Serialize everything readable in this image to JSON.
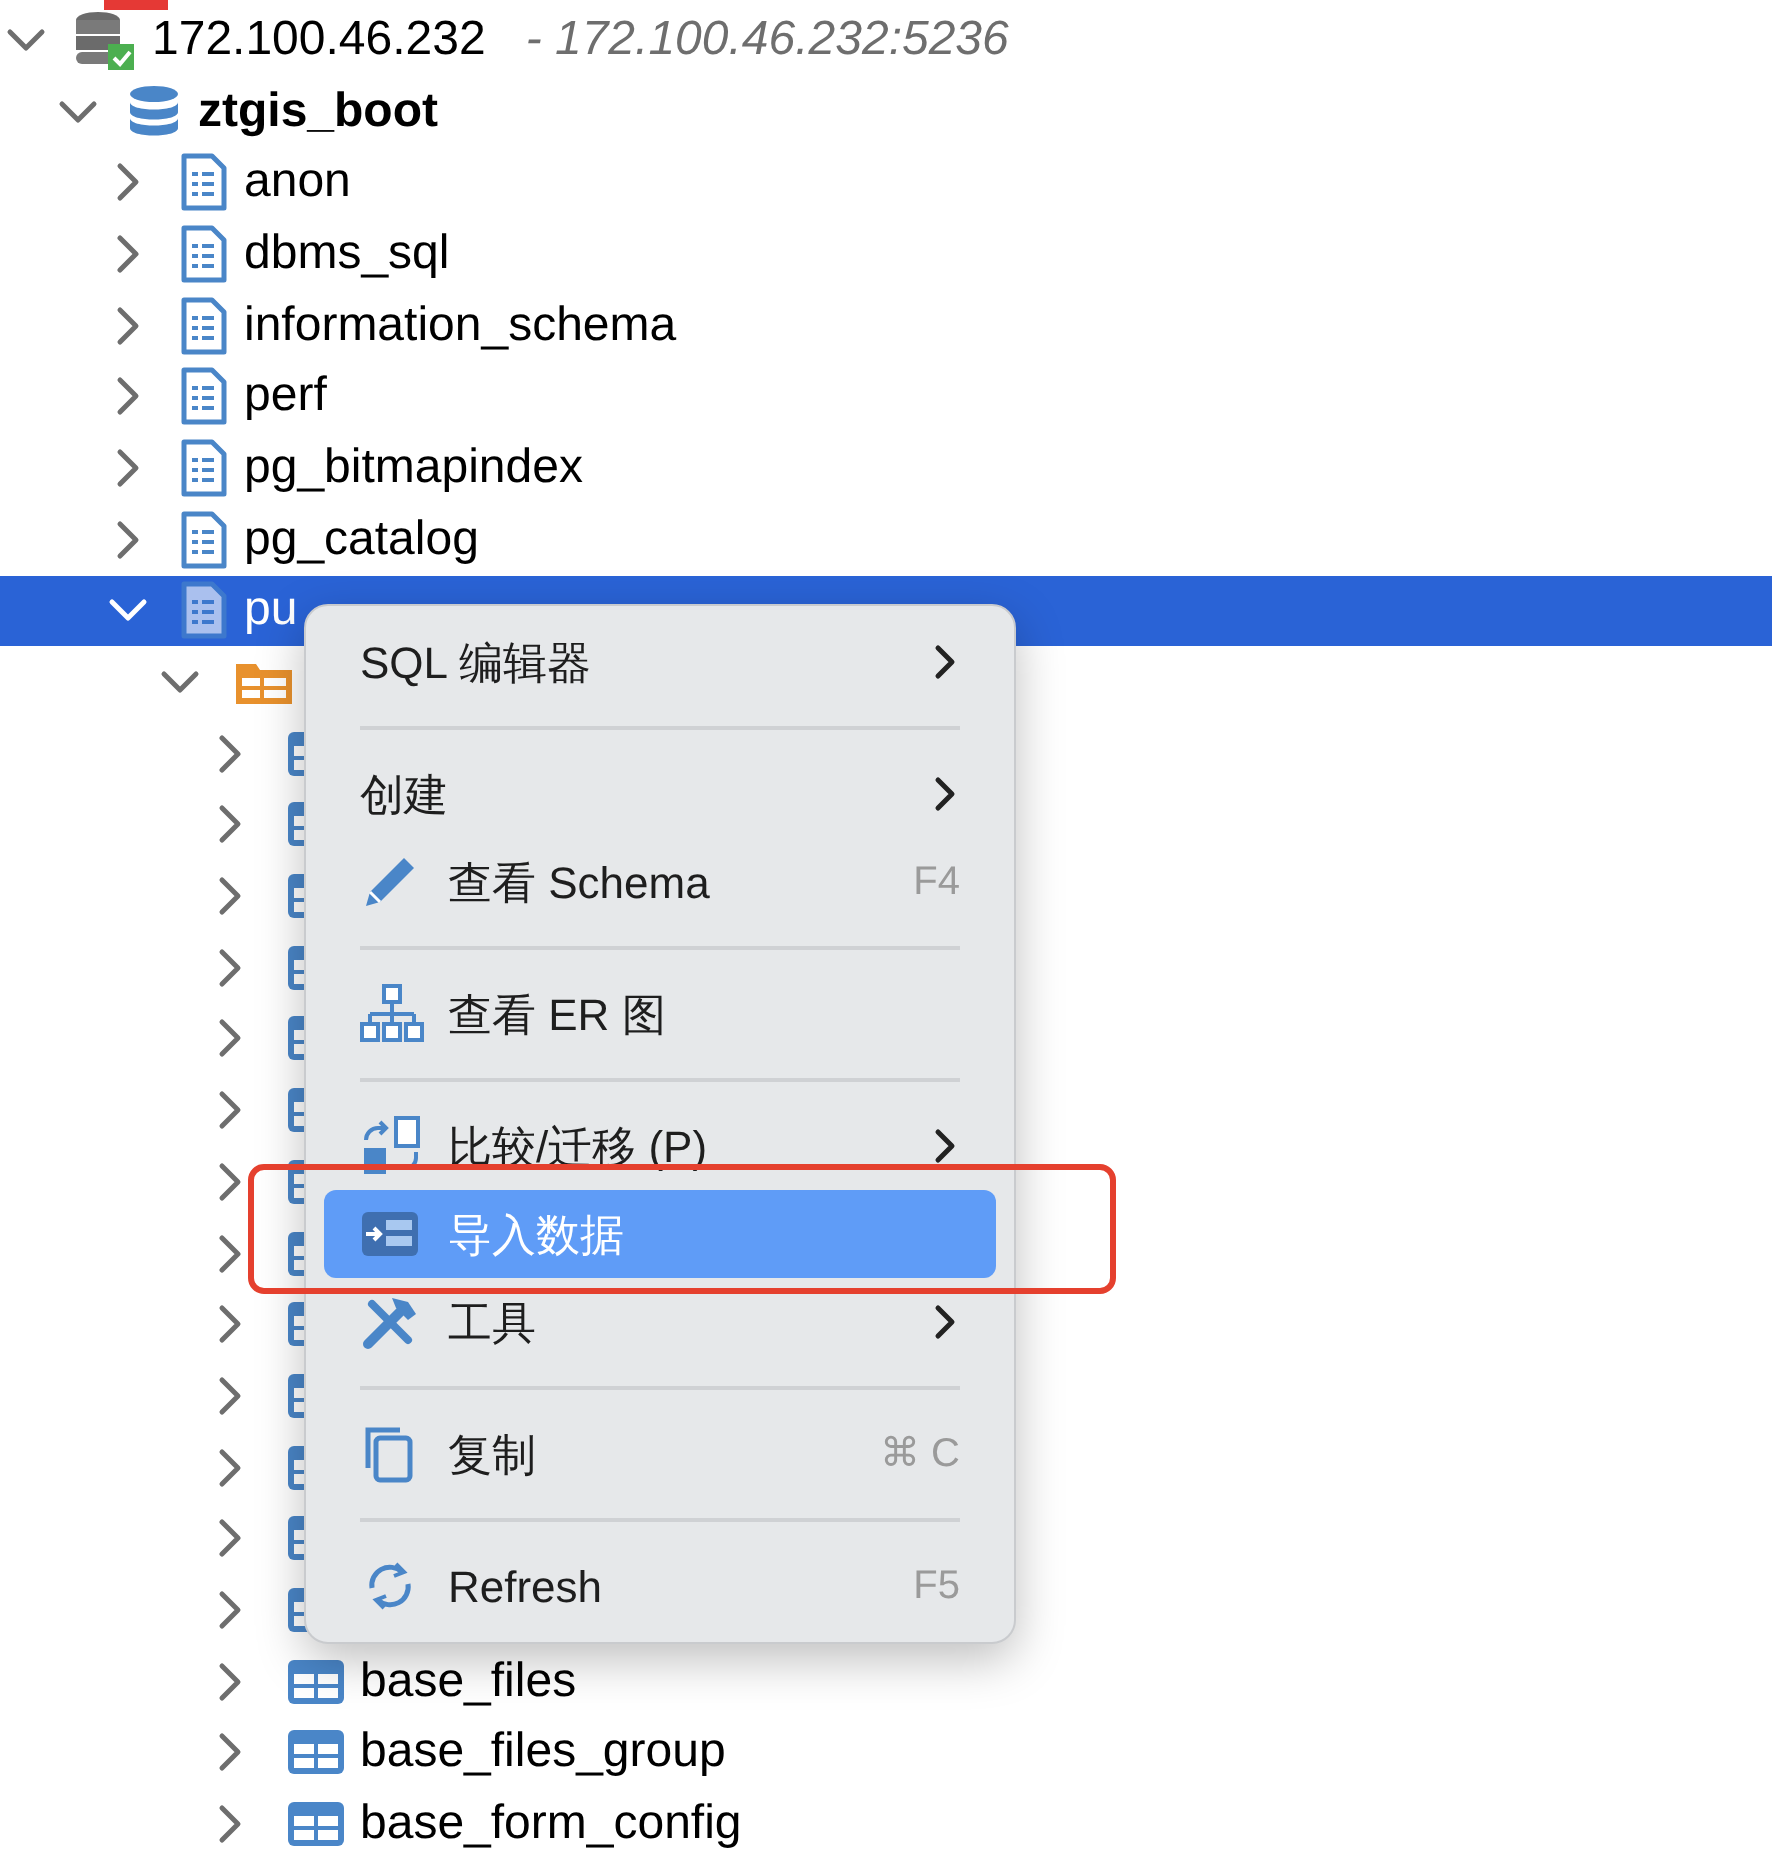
{
  "tree": [
    {
      "label": "172.100.46.232",
      "detail": "- 172.100.46.232:5236",
      "kind": "server",
      "expanded": true,
      "selected": false,
      "children": [
        {
          "label": "ztgis_boot",
          "kind": "database",
          "expanded": true,
          "selected": false,
          "children": [
            {
              "label": "anon",
              "kind": "schema",
              "expanded": false,
              "selected": false
            },
            {
              "label": "dbms_sql",
              "kind": "schema",
              "expanded": false,
              "selected": false
            },
            {
              "label": "information_schema",
              "kind": "schema",
              "expanded": false,
              "selected": false
            },
            {
              "label": "perf",
              "kind": "schema",
              "expanded": false,
              "selected": false
            },
            {
              "label": "pg_bitmapindex",
              "kind": "schema",
              "expanded": false,
              "selected": false
            },
            {
              "label": "pg_catalog",
              "kind": "schema",
              "expanded": false,
              "selected": false
            },
            {
              "label": "pu",
              "kind": "schema",
              "expanded": true,
              "selected": true,
              "children": [
                {
                  "kind": "folder",
                  "expanded": true,
                  "selected": false,
                  "children": [
                    {
                      "kind": "table",
                      "expanded": false,
                      "selected": false
                    },
                    {
                      "kind": "table",
                      "expanded": false,
                      "selected": false
                    },
                    {
                      "kind": "table",
                      "expanded": false,
                      "selected": false
                    },
                    {
                      "kind": "table",
                      "expanded": false,
                      "selected": false
                    },
                    {
                      "kind": "table",
                      "expanded": false,
                      "selected": false
                    },
                    {
                      "kind": "table",
                      "expanded": false,
                      "selected": false
                    },
                    {
                      "kind": "table",
                      "expanded": false,
                      "selected": false
                    },
                    {
                      "kind": "table",
                      "expanded": false,
                      "selected": false
                    },
                    {
                      "kind": "table",
                      "expanded": false,
                      "selected": false
                    },
                    {
                      "kind": "table",
                      "expanded": false,
                      "selected": false
                    },
                    {
                      "kind": "table",
                      "expanded": false,
                      "selected": false
                    },
                    {
                      "kind": "table",
                      "expanded": false,
                      "selected": false
                    },
                    {
                      "kind": "table",
                      "expanded": false,
                      "selected": false
                    },
                    {
                      "label": "base_files",
                      "kind": "table",
                      "expanded": false,
                      "selected": false
                    },
                    {
                      "label": "base_files_group",
                      "kind": "table",
                      "expanded": false,
                      "selected": false
                    },
                    {
                      "label": "base_form_config",
                      "kind": "table",
                      "expanded": false,
                      "selected": false
                    }
                  ]
                }
              ]
            }
          ]
        }
      ]
    }
  ],
  "context_menu": [
    {
      "kind": "item",
      "label": "SQL 编辑器",
      "submenu": true,
      "selected": false
    },
    {
      "kind": "separator"
    },
    {
      "kind": "item",
      "label": "创建",
      "submenu": true,
      "selected": false
    },
    {
      "kind": "pencil",
      "label": "查看 Schema",
      "shortcut": "F4",
      "submenu": false,
      "selected": false
    },
    {
      "kind": "separator"
    },
    {
      "kind": "diagram",
      "label": "查看 ER 图",
      "submenu": false,
      "selected": false
    },
    {
      "kind": "separator"
    },
    {
      "kind": "compare",
      "label": "比较/迁移 (P)",
      "submenu": true,
      "selected": false
    },
    {
      "kind": "import",
      "label": "导入数据",
      "submenu": false,
      "selected": true
    },
    {
      "kind": "tools",
      "label": "工具",
      "submenu": true,
      "selected": false
    },
    {
      "kind": "separator"
    },
    {
      "kind": "copy",
      "label": "复制",
      "shortcut": "⌘ C",
      "submenu": false,
      "selected": false
    },
    {
      "kind": "separator"
    },
    {
      "kind": "refresh",
      "label": "Refresh",
      "shortcut": "F5",
      "submenu": false,
      "selected": false
    }
  ]
}
